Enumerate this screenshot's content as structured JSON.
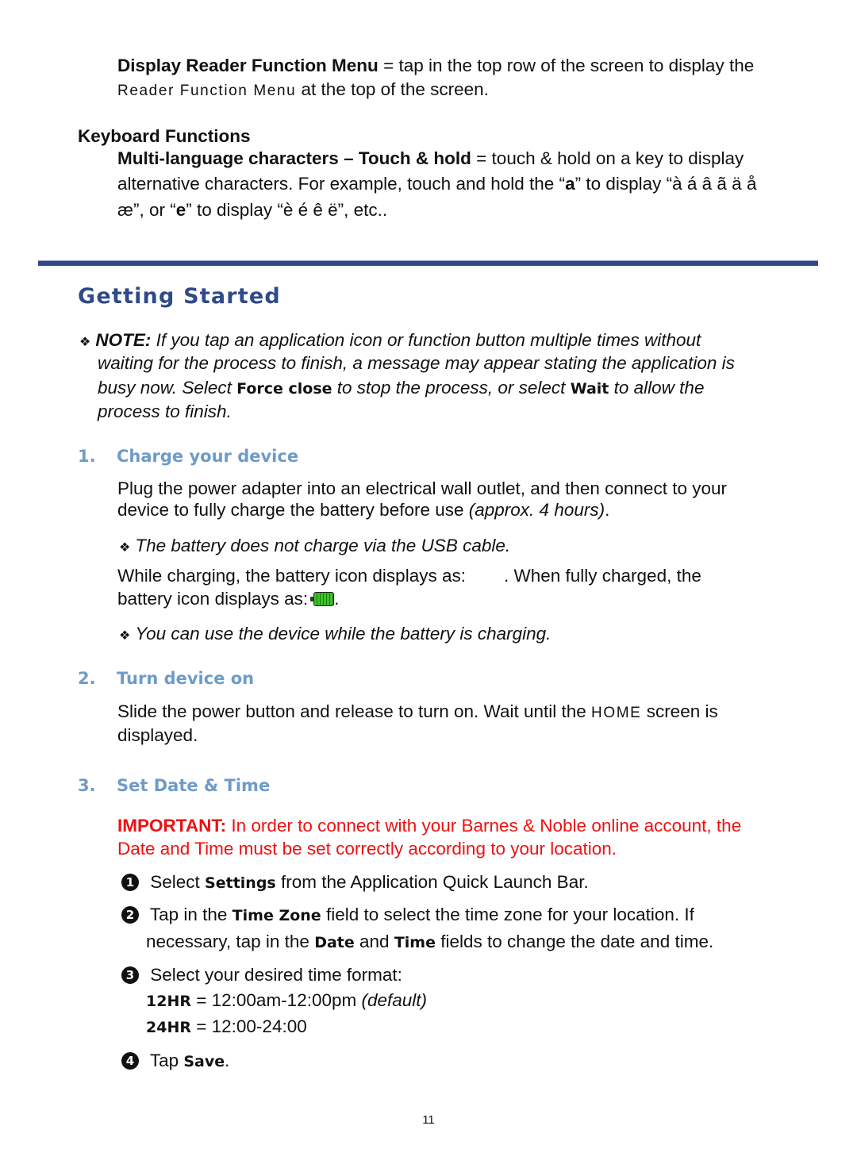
{
  "top": {
    "reader_menu": {
      "term": "Display Reader Function Menu",
      "desc_1": " = tap in the top row of the screen to display the",
      "menu_name": "Reader Function Menu",
      "desc_2": " at the top of the screen."
    },
    "keyboard": {
      "heading": "Keyboard Functions",
      "term": "Multi-language characters – Touch & hold",
      "desc_1": " = touch & hold on a key to display",
      "line2_a": "alternative characters. For example, touch and hold the “",
      "key_a": "a",
      "line2_b": "” to display “à á â ã ä å",
      "line3_a": "æ”, or “",
      "key_e": "e",
      "line3_b": "” to display “è é ê ë”, etc.."
    }
  },
  "section": {
    "title": "Getting Started",
    "accent_color": "#2f4a8a",
    "note": {
      "bullet_icon": "❖",
      "label": "NOTE:",
      "line1": " If you tap an application icon or function button multiple times without",
      "line2": "waiting for the process to finish, a message may appear stating the application is",
      "line3_a": "busy now. Select ",
      "force_close": "Force close",
      "line3_b": " to stop the process, or select ",
      "wait": "Wait",
      "line3_c": " to allow the",
      "line4": "process to finish."
    }
  },
  "steps": [
    {
      "number": "1.",
      "title": "Charge your device",
      "para1_line1": "Plug the power adapter into an electrical wall outlet, and then connect to your",
      "para1_line2_a": "device to fully charge the battery before use ",
      "para1_line2_b": "(approx. 4 hours)",
      "para1_line2_c": ".",
      "tip1": "The battery does not charge via the USB cable.",
      "charging_line1_a": "While charging, the battery icon displays as:",
      "charging_line1_b": ". When fully charged, the",
      "charging_line2": "battery icon displays as:",
      "charging_line2_end": ".",
      "battery_full_level": 100,
      "tip2": "You can use the device while the battery is charging."
    },
    {
      "number": "2.",
      "title": "Turn device on",
      "line1_a": "Slide the power button and release to turn on. Wait until the ",
      "home": "HOME",
      "line1_b": " screen is",
      "line2": "displayed."
    },
    {
      "number": "3.",
      "title": "Set Date & Time",
      "important_label": "IMPORTANT:",
      "important_line1": " In order to connect with your Barnes & Noble online account, the",
      "important_line2": "Date and Time must be set correctly according to your location.",
      "important_color": "#ee1111",
      "substeps": [
        {
          "marker": "1",
          "a": " Select ",
          "b": "Settings",
          "c": " from the Application Quick Launch Bar."
        },
        {
          "marker": "2",
          "a": " Tap in the ",
          "b": "Time Zone",
          "c": " field to select the time zone for your location. If",
          "line2_a": "necessary, tap in the ",
          "line2_b": "Date",
          "line2_c": " and ",
          "line2_d": "Time",
          "line2_e": " fields to change the date and time."
        },
        {
          "marker": "3",
          "a": " Select your desired time format:",
          "fmt12_label": "12HR",
          "fmt12_value": " = 12:00am-12:00pm ",
          "fmt12_note": "(default)",
          "fmt24_label": "24HR",
          "fmt24_value": " = 12:00-24:00"
        },
        {
          "marker": "4",
          "a": " Tap ",
          "b": "Save",
          "c": "."
        }
      ]
    }
  ],
  "footer": {
    "page_number": "11"
  }
}
